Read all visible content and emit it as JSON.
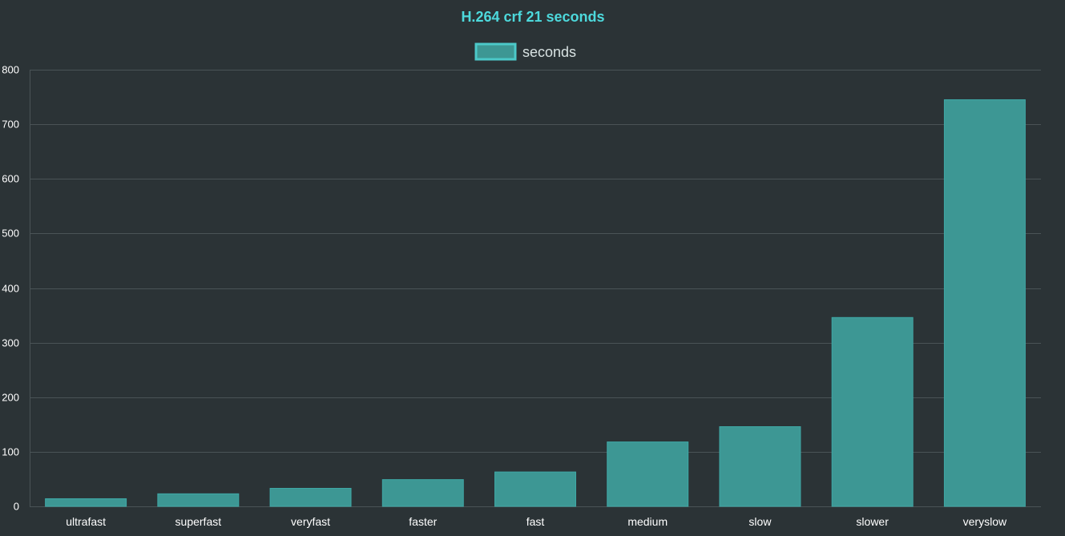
{
  "colors": {
    "background": "#2b3336",
    "title": "#4dd9dc",
    "bar_fill": "#3d9794",
    "bar_stroke": "#3fa8a6",
    "legend_swatch_fill": "#3d9794",
    "legend_swatch_stroke": "#4cc9c9",
    "legend_text": "#d8e2e2",
    "grid": "#4a5356",
    "tick_text": "#ffffff"
  },
  "chart_data": {
    "type": "bar",
    "title": "H.264 crf 21 seconds",
    "legend": {
      "position": "top",
      "entries": [
        "seconds"
      ]
    },
    "categories": [
      "ultrafast",
      "superfast",
      "veryfast",
      "faster",
      "fast",
      "medium",
      "slow",
      "slower",
      "veryslow"
    ],
    "series": [
      {
        "name": "seconds",
        "values": [
          14,
          23,
          33,
          49,
          63,
          118,
          146,
          346,
          745
        ]
      }
    ],
    "ylim": [
      0,
      800
    ],
    "yticks": [
      0,
      100,
      200,
      300,
      400,
      500,
      600,
      700,
      800
    ],
    "ytick_labels": [
      "0",
      "100",
      "200",
      "300",
      "400",
      "500",
      "600",
      "700",
      "800"
    ],
    "grid": true
  }
}
